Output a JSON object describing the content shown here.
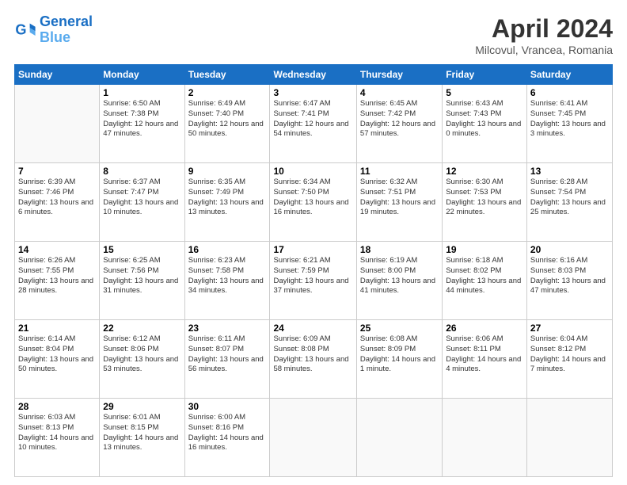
{
  "header": {
    "logo_line1": "General",
    "logo_line2": "Blue",
    "title": "April 2024",
    "location": "Milcovul, Vrancea, Romania"
  },
  "days_of_week": [
    "Sunday",
    "Monday",
    "Tuesday",
    "Wednesday",
    "Thursday",
    "Friday",
    "Saturday"
  ],
  "weeks": [
    [
      {
        "day": null
      },
      {
        "day": "1",
        "sunrise": "6:50 AM",
        "sunset": "7:38 PM",
        "daylight": "12 hours and 47 minutes."
      },
      {
        "day": "2",
        "sunrise": "6:49 AM",
        "sunset": "7:40 PM",
        "daylight": "12 hours and 50 minutes."
      },
      {
        "day": "3",
        "sunrise": "6:47 AM",
        "sunset": "7:41 PM",
        "daylight": "12 hours and 54 minutes."
      },
      {
        "day": "4",
        "sunrise": "6:45 AM",
        "sunset": "7:42 PM",
        "daylight": "12 hours and 57 minutes."
      },
      {
        "day": "5",
        "sunrise": "6:43 AM",
        "sunset": "7:43 PM",
        "daylight": "13 hours and 0 minutes."
      },
      {
        "day": "6",
        "sunrise": "6:41 AM",
        "sunset": "7:45 PM",
        "daylight": "13 hours and 3 minutes."
      }
    ],
    [
      {
        "day": "7",
        "sunrise": "6:39 AM",
        "sunset": "7:46 PM",
        "daylight": "13 hours and 6 minutes."
      },
      {
        "day": "8",
        "sunrise": "6:37 AM",
        "sunset": "7:47 PM",
        "daylight": "13 hours and 10 minutes."
      },
      {
        "day": "9",
        "sunrise": "6:35 AM",
        "sunset": "7:49 PM",
        "daylight": "13 hours and 13 minutes."
      },
      {
        "day": "10",
        "sunrise": "6:34 AM",
        "sunset": "7:50 PM",
        "daylight": "13 hours and 16 minutes."
      },
      {
        "day": "11",
        "sunrise": "6:32 AM",
        "sunset": "7:51 PM",
        "daylight": "13 hours and 19 minutes."
      },
      {
        "day": "12",
        "sunrise": "6:30 AM",
        "sunset": "7:53 PM",
        "daylight": "13 hours and 22 minutes."
      },
      {
        "day": "13",
        "sunrise": "6:28 AM",
        "sunset": "7:54 PM",
        "daylight": "13 hours and 25 minutes."
      }
    ],
    [
      {
        "day": "14",
        "sunrise": "6:26 AM",
        "sunset": "7:55 PM",
        "daylight": "13 hours and 28 minutes."
      },
      {
        "day": "15",
        "sunrise": "6:25 AM",
        "sunset": "7:56 PM",
        "daylight": "13 hours and 31 minutes."
      },
      {
        "day": "16",
        "sunrise": "6:23 AM",
        "sunset": "7:58 PM",
        "daylight": "13 hours and 34 minutes."
      },
      {
        "day": "17",
        "sunrise": "6:21 AM",
        "sunset": "7:59 PM",
        "daylight": "13 hours and 37 minutes."
      },
      {
        "day": "18",
        "sunrise": "6:19 AM",
        "sunset": "8:00 PM",
        "daylight": "13 hours and 41 minutes."
      },
      {
        "day": "19",
        "sunrise": "6:18 AM",
        "sunset": "8:02 PM",
        "daylight": "13 hours and 44 minutes."
      },
      {
        "day": "20",
        "sunrise": "6:16 AM",
        "sunset": "8:03 PM",
        "daylight": "13 hours and 47 minutes."
      }
    ],
    [
      {
        "day": "21",
        "sunrise": "6:14 AM",
        "sunset": "8:04 PM",
        "daylight": "13 hours and 50 minutes."
      },
      {
        "day": "22",
        "sunrise": "6:12 AM",
        "sunset": "8:06 PM",
        "daylight": "13 hours and 53 minutes."
      },
      {
        "day": "23",
        "sunrise": "6:11 AM",
        "sunset": "8:07 PM",
        "daylight": "13 hours and 56 minutes."
      },
      {
        "day": "24",
        "sunrise": "6:09 AM",
        "sunset": "8:08 PM",
        "daylight": "13 hours and 58 minutes."
      },
      {
        "day": "25",
        "sunrise": "6:08 AM",
        "sunset": "8:09 PM",
        "daylight": "14 hours and 1 minute."
      },
      {
        "day": "26",
        "sunrise": "6:06 AM",
        "sunset": "8:11 PM",
        "daylight": "14 hours and 4 minutes."
      },
      {
        "day": "27",
        "sunrise": "6:04 AM",
        "sunset": "8:12 PM",
        "daylight": "14 hours and 7 minutes."
      }
    ],
    [
      {
        "day": "28",
        "sunrise": "6:03 AM",
        "sunset": "8:13 PM",
        "daylight": "14 hours and 10 minutes."
      },
      {
        "day": "29",
        "sunrise": "6:01 AM",
        "sunset": "8:15 PM",
        "daylight": "14 hours and 13 minutes."
      },
      {
        "day": "30",
        "sunrise": "6:00 AM",
        "sunset": "8:16 PM",
        "daylight": "14 hours and 16 minutes."
      },
      {
        "day": null
      },
      {
        "day": null
      },
      {
        "day": null
      },
      {
        "day": null
      }
    ]
  ],
  "labels": {
    "sunrise": "Sunrise:",
    "sunset": "Sunset:",
    "daylight": "Daylight:"
  }
}
